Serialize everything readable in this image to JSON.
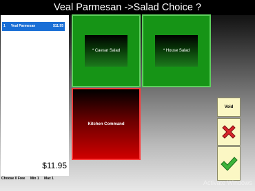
{
  "header": {
    "title": "Veal Parmesan ->Salad Choice ?"
  },
  "order": {
    "items": [
      {
        "qty": "1",
        "name": "Veal Parmesan",
        "price": "$11.95"
      }
    ],
    "total": "$11.95"
  },
  "footer": {
    "choose_free": "Choose 0 Free",
    "min": "Min 1",
    "max": "Max 1"
  },
  "choices": [
    {
      "label": "* Caesar Salad"
    },
    {
      "label": "* House Salad"
    }
  ],
  "kitchen_command": {
    "label": "Kitchen Command"
  },
  "actions": {
    "void_label": "Void"
  },
  "watermark": {
    "text": "Activate Windows"
  },
  "colors": {
    "choice_tile": "#169416",
    "kitchen_tile": "#d00000",
    "selected_item": "#1a6fd6",
    "action_button": "#fbf7c4"
  }
}
